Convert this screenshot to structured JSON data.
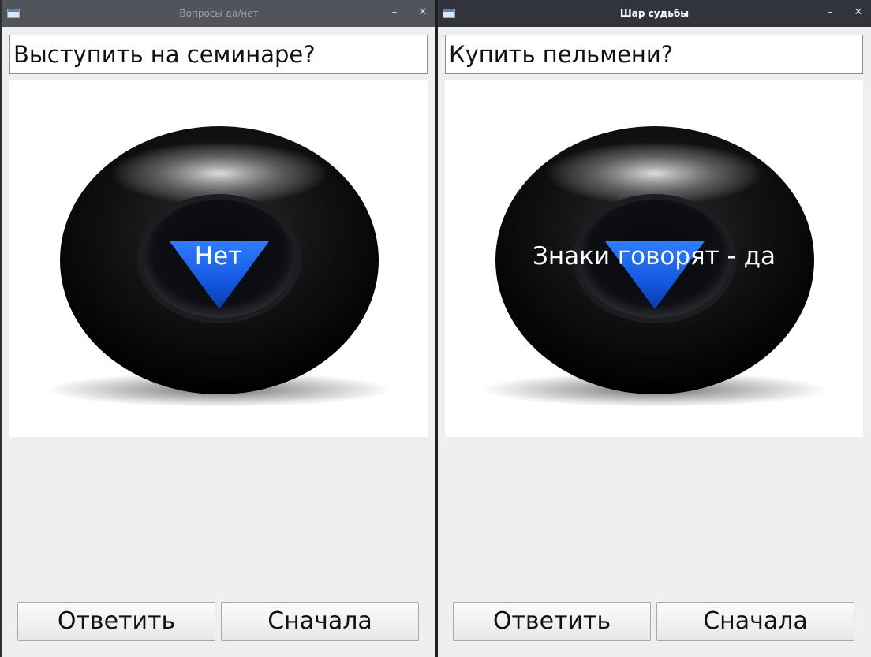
{
  "windows": [
    {
      "id": "left",
      "title": "Вопросы да/нет",
      "question_value": "Выступить на семинаре?",
      "answer": "Нет",
      "buttons": {
        "answer": "Ответить",
        "reset": "Сначала"
      },
      "controls": {
        "minimize": "–",
        "close": "✕"
      }
    },
    {
      "id": "right",
      "title": "Шар судьбы",
      "question_value": "Купить пельмени?",
      "answer": "Знаки говорят - да",
      "buttons": {
        "answer": "Ответить",
        "reset": "Сначала"
      },
      "controls": {
        "minimize": "–",
        "close": "✕"
      }
    }
  ],
  "icons": {
    "app": "window-app-icon",
    "ball": "magic-8-ball-icon"
  },
  "colors": {
    "titlebar": "#31343d",
    "triangle": "#1f6bff",
    "ball": "#0a0a0a"
  }
}
